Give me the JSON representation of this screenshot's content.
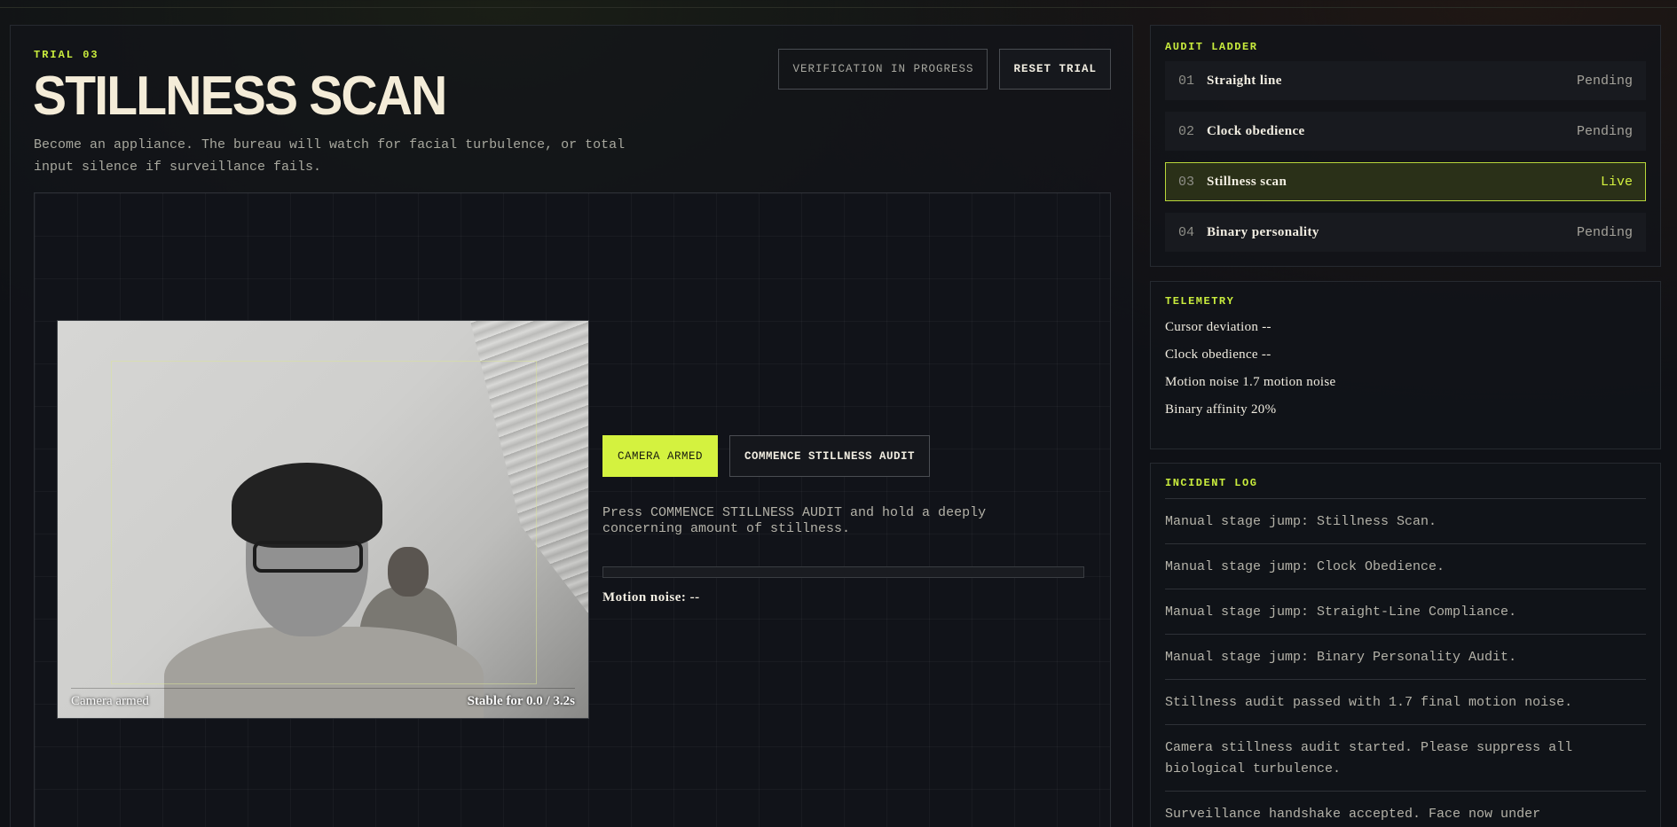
{
  "header": {
    "trial_label": "TRIAL 03",
    "title": "STILLNESS SCAN",
    "subtitle": "Become an appliance. The bureau will watch for facial turbulence, or total input silence if surveillance fails.",
    "verification_label": "VERIFICATION IN PROGRESS",
    "reset_label": "RESET TRIAL"
  },
  "camera": {
    "status_left": "Camera armed",
    "status_right": "Stable for 0.0 / 3.2s"
  },
  "controls": {
    "armed_label": "CAMERA ARMED",
    "commence_label": "COMMENCE STILLNESS AUDIT",
    "instructions": "Press COMMENCE STILLNESS AUDIT and hold a deeply concerning amount of stillness.",
    "progress_fraction": 0,
    "motion_readout": "Motion noise: --"
  },
  "audit_ladder": {
    "title": "AUDIT LADDER",
    "items": [
      {
        "num": "01",
        "name": "Straight line",
        "status": "Pending"
      },
      {
        "num": "02",
        "name": "Clock obedience",
        "status": "Pending"
      },
      {
        "num": "03",
        "name": "Stillness scan",
        "status": "Live"
      },
      {
        "num": "04",
        "name": "Binary personality",
        "status": "Pending"
      }
    ]
  },
  "telemetry": {
    "title": "TELEMETRY",
    "rows": [
      "Cursor deviation --",
      "Clock obedience --",
      "Motion noise 1.7 motion noise",
      "Binary affinity 20%"
    ]
  },
  "incident_log": {
    "title": "INCIDENT LOG",
    "entries": [
      "Manual stage jump: Stillness Scan.",
      "Manual stage jump: Clock Obedience.",
      "Manual stage jump: Straight-Line Compliance.",
      "Manual stage jump: Binary Personality Audit.",
      "Stillness audit passed with 1.7 final motion noise.",
      "Camera stillness audit started. Please suppress all biological turbulence.",
      "Surveillance handshake accepted. Face now under"
    ]
  },
  "colors": {
    "accent": "#d4f23f",
    "background": "#0f1116"
  }
}
